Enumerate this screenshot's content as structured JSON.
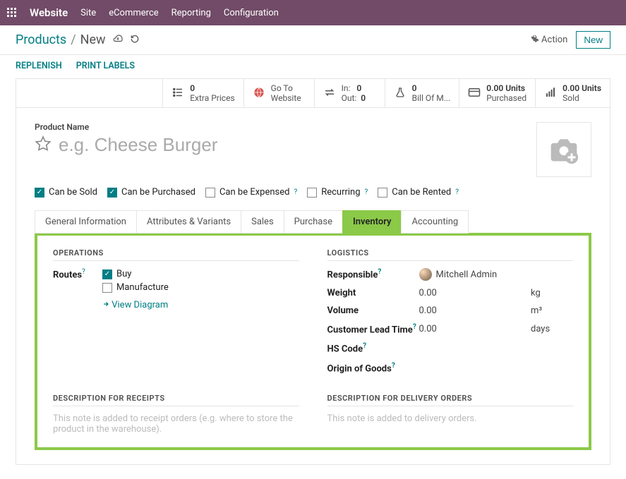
{
  "topbar": {
    "brand": "Website",
    "menu": [
      "Site",
      "eCommerce",
      "Reporting",
      "Configuration"
    ]
  },
  "breadcrumbs": {
    "root": "Products",
    "current": "New",
    "action_label": "Action",
    "new_label": "New"
  },
  "actions": {
    "replenish": "REPLENISH",
    "print_labels": "PRINT LABELS"
  },
  "counters": {
    "extra_prices": {
      "value": "0",
      "label": "Extra Prices"
    },
    "goto_website": {
      "line1": "Go To",
      "line2": "Website"
    },
    "inout": {
      "in_label": "In:",
      "in_value": "0",
      "out_label": "Out:",
      "out_value": "0"
    },
    "bom": {
      "value": "0",
      "label": "Bill Of M..."
    },
    "purchased": {
      "value": "0.00 Units",
      "label": "Purchased"
    },
    "sold": {
      "value": "0.00 Units",
      "label": "Sold"
    }
  },
  "product": {
    "name_label": "Product Name",
    "name_placeholder": "e.g. Cheese Burger",
    "checks": {
      "can_be_sold": "Can be Sold",
      "can_be_purchased": "Can be Purchased",
      "can_be_expensed": "Can be Expensed",
      "recurring": "Recurring",
      "can_be_rented": "Can be Rented"
    }
  },
  "tabs": {
    "items": [
      "General Information",
      "Attributes & Variants",
      "Sales",
      "Purchase",
      "Inventory",
      "Accounting"
    ],
    "active": "Inventory"
  },
  "inventory": {
    "operations": {
      "title": "OPERATIONS",
      "routes_label": "Routes",
      "buy": "Buy",
      "manufacture": "Manufacture",
      "view_diagram": "View Diagram"
    },
    "logistics": {
      "title": "LOGISTICS",
      "responsible_label": "Responsible",
      "responsible_value": "Mitchell Admin",
      "weight_label": "Weight",
      "weight_value": "0.00",
      "weight_unit": "kg",
      "volume_label": "Volume",
      "volume_value": "0.00",
      "volume_unit": "m³",
      "lead_label": "Customer Lead Time",
      "lead_value": "0.00",
      "lead_unit": "days",
      "hs_label": "HS Code",
      "origin_label": "Origin of Goods"
    },
    "desc_receipts": {
      "title": "DESCRIPTION FOR RECEIPTS",
      "placeholder": "This note is added to receipt orders (e.g. where to store the product in the warehouse)."
    },
    "desc_delivery": {
      "title": "DESCRIPTION FOR DELIVERY ORDERS",
      "placeholder": "This note is added to delivery orders."
    }
  }
}
